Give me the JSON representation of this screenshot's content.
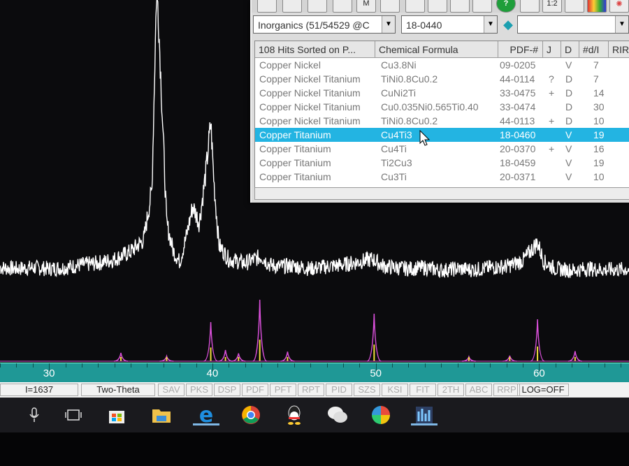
{
  "search_window": {
    "database_combo": "Inorganics (51/54529 @C",
    "pdf_combo": "18-0440",
    "second_combo": "",
    "toolbar_labels": {
      "zoom": "1:2",
      "m": "M"
    },
    "columns": [
      "108 Hits Sorted on P...",
      "Chemical Formula",
      "PDF-#",
      "J",
      "D",
      "#d/I",
      "RIR"
    ],
    "rows": [
      {
        "name": "Copper Nickel",
        "formula": "Cu3.8Ni",
        "pdf": "09-0205",
        "j": "",
        "d": "V",
        "di": "7"
      },
      {
        "name": "Copper Nickel Titanium",
        "formula": "TiNi0.8Cu0.2",
        "pdf": "44-0114",
        "j": "?",
        "d": "D",
        "di": "7"
      },
      {
        "name": "Copper Nickel Titanium",
        "formula": "CuNi2Ti",
        "pdf": "33-0475",
        "j": "+",
        "d": "D",
        "di": "14"
      },
      {
        "name": "Copper Nickel Titanium",
        "formula": "Cu0.035Ni0.565Ti0.40",
        "pdf": "33-0474",
        "j": "",
        "d": "D",
        "di": "30"
      },
      {
        "name": "Copper Nickel Titanium",
        "formula": "TiNi0.8Cu0.2",
        "pdf": "44-0113",
        "j": "+",
        "d": "D",
        "di": "10"
      },
      {
        "name": "Copper Titanium",
        "formula": "Cu4Ti3",
        "pdf": "18-0460",
        "j": "",
        "d": "V",
        "di": "19",
        "selected": true
      },
      {
        "name": "Copper Titanium",
        "formula": "Cu4Ti",
        "pdf": "20-0370",
        "j": "+",
        "d": "V",
        "di": "16"
      },
      {
        "name": "Copper Titanium",
        "formula": "Ti2Cu3",
        "pdf": "18-0459",
        "j": "",
        "d": "V",
        "di": "19"
      },
      {
        "name": "Copper Titanium",
        "formula": "Cu3Ti",
        "pdf": "20-0371",
        "j": "",
        "d": "V",
        "di": "10"
      }
    ]
  },
  "chart_data": {
    "type": "line",
    "x_ticks": [
      "30",
      "40",
      "50",
      "60"
    ],
    "xlim": [
      27,
      65.5
    ],
    "series": [
      {
        "color": "#ffffff",
        "points": [
          [
            27,
            120
          ],
          [
            28,
            118
          ],
          [
            29,
            120
          ],
          [
            30,
            118
          ],
          [
            31,
            120
          ],
          [
            32,
            125
          ],
          [
            33,
            128
          ],
          [
            34,
            135
          ],
          [
            35,
            148
          ],
          [
            35.8,
            170
          ],
          [
            36.3,
            260
          ],
          [
            36.6,
            640
          ],
          [
            36.9,
            420
          ],
          [
            37.2,
            200
          ],
          [
            37.6,
            150
          ],
          [
            38,
            130
          ],
          [
            38.4,
            175
          ],
          [
            38.8,
            230
          ],
          [
            39.2,
            200
          ],
          [
            39.6,
            290
          ],
          [
            39.9,
            380
          ],
          [
            40.1,
            270
          ],
          [
            40.4,
            160
          ],
          [
            41,
            135
          ],
          [
            42,
            128
          ],
          [
            43,
            140
          ],
          [
            43.5,
            125
          ],
          [
            44,
            122
          ],
          [
            45,
            123
          ],
          [
            46,
            118
          ],
          [
            47,
            122
          ],
          [
            48,
            125
          ],
          [
            49.8,
            135
          ],
          [
            50.5,
            122
          ],
          [
            52,
            118
          ],
          [
            53,
            120
          ],
          [
            54,
            115
          ],
          [
            55,
            118
          ],
          [
            56,
            116
          ],
          [
            57,
            120
          ],
          [
            58,
            122
          ],
          [
            59,
            132
          ],
          [
            59.9,
            165
          ],
          [
            60.3,
            130
          ],
          [
            61,
            118
          ],
          [
            62,
            115
          ],
          [
            63,
            118
          ],
          [
            64,
            116
          ],
          [
            65.5,
            117
          ]
        ]
      },
      {
        "name": "Cu4Ti3",
        "color": "#d84fd8",
        "peaks": [
          [
            34.4,
            15
          ],
          [
            37.2,
            9
          ],
          [
            39.9,
            70
          ],
          [
            40.8,
            20
          ],
          [
            41.6,
            14
          ],
          [
            42.9,
            110
          ],
          [
            44.6,
            17
          ],
          [
            49.9,
            85
          ],
          [
            55.7,
            8
          ],
          [
            58.2,
            10
          ],
          [
            59.9,
            75
          ],
          [
            62.2,
            18
          ]
        ]
      }
    ]
  },
  "axis": {
    "ticks_min": 27,
    "ticks_max": 65
  },
  "status_bar": {
    "intensity": "I=1637",
    "mode": "Two-Theta",
    "buttons": [
      "SAV",
      "PKS",
      "DSP",
      "PDF",
      "PFT",
      "RPT",
      "PID",
      "SZS",
      "KSI",
      "FIT",
      "2TH",
      "ABC",
      "RRP"
    ],
    "log": "LOG=OFF"
  },
  "taskbar": {
    "icons": [
      "microphone-icon",
      "task-view-icon",
      "store-icon",
      "file-explorer-icon",
      "edge-icon",
      "chrome-icon",
      "qq-icon",
      "wechat-icon",
      "pinwheel-icon",
      "jade-app-icon"
    ]
  }
}
